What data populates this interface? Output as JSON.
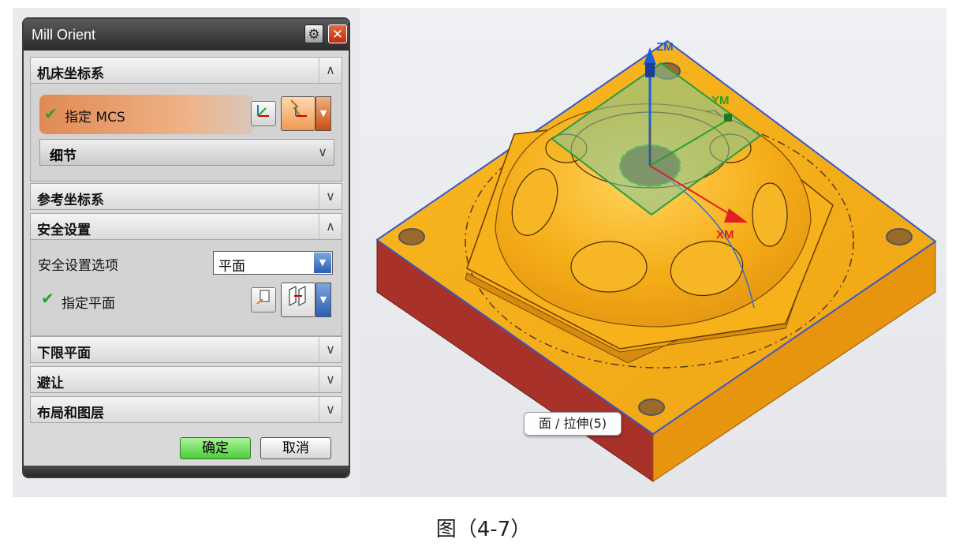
{
  "dialog": {
    "title": "Mill Orient",
    "gear_icon": "gear-icon",
    "close_icon": "close-icon",
    "sections": {
      "mcs": {
        "label": "机床坐标系",
        "expanded": true
      },
      "reference": {
        "label": "参考坐标系",
        "expanded": false
      },
      "safety": {
        "label": "安全设置",
        "expanded": true
      },
      "lower_plane": {
        "label": "下限平面",
        "expanded": false
      },
      "avoidance": {
        "label": "避让",
        "expanded": false
      },
      "layout": {
        "label": "布局和图层",
        "expanded": false
      }
    },
    "mcs_row": {
      "label": "指定 MCS",
      "status": "checked"
    },
    "detail": {
      "label": "细节"
    },
    "safety_option": {
      "label": "安全设置选项",
      "value": "平面"
    },
    "plane_row": {
      "label": "指定平面",
      "status": "checked"
    },
    "ok_label": "确定",
    "cancel_label": "取消"
  },
  "viewport": {
    "axes": {
      "z": "ZM",
      "y": "YM",
      "x": "XM"
    },
    "tooltip": "面 / 拉伸(5)",
    "colors": {
      "part": "#f5b21a",
      "side": "#a8322a",
      "plane": "#7fc79a",
      "accent": "#2e6fd6"
    }
  },
  "caption": "图（4-7）"
}
